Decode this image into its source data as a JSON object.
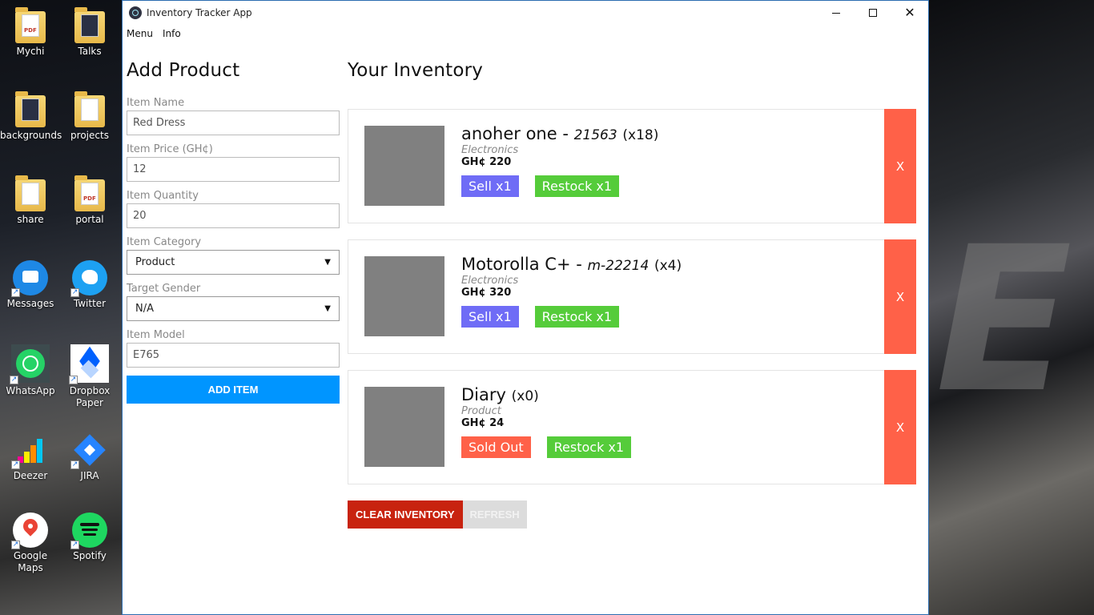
{
  "desktop": {
    "icons": [
      {
        "label": "Mychi"
      },
      {
        "label": "Talks"
      },
      {
        "label": "backgrounds"
      },
      {
        "label": "projects"
      },
      {
        "label": "share"
      },
      {
        "label": "portal"
      },
      {
        "label": "Messages"
      },
      {
        "label": "Twitter"
      },
      {
        "label": "WhatsApp"
      },
      {
        "label": "Dropbox Paper"
      },
      {
        "label": "Deezer"
      },
      {
        "label": "JIRA"
      },
      {
        "label": "Google Maps"
      },
      {
        "label": "Spotify"
      }
    ]
  },
  "window": {
    "title": "Inventory Tracker App",
    "menu": [
      "Menu",
      "Info"
    ]
  },
  "form": {
    "title": "Add Product",
    "item_name_label": "Item Name",
    "item_name_value": "Red Dress",
    "item_price_label": "Item Price (GH¢)",
    "item_price_value": "12",
    "item_quantity_label": "Item Quantity",
    "item_quantity_value": "20",
    "item_category_label": "Item Category",
    "item_category_value": "Product",
    "target_gender_label": "Target Gender",
    "target_gender_value": "N/A",
    "item_model_label": "Item Model",
    "item_model_value": "E765",
    "add_button": "ADD ITEM"
  },
  "inventory": {
    "title": "Your Inventory",
    "items": [
      {
        "name": "anoher one",
        "separator": " - ",
        "model": "21563",
        "qty": "(x18)",
        "category": "Electronics",
        "price": "GH¢ 220",
        "sell_label": "Sell x1",
        "restock_label": "Restock x1",
        "delete_label": "X"
      },
      {
        "name": "Motorolla C+",
        "separator": " - ",
        "model": "m-22214",
        "qty": "(x4)",
        "category": "Electronics",
        "price": "GH¢ 320",
        "sell_label": "Sell x1",
        "restock_label": "Restock x1",
        "delete_label": "X"
      },
      {
        "name": "Diary",
        "separator": "",
        "model": "",
        "qty": "(x0)",
        "category": "Product",
        "price": "GH¢ 24",
        "sell_label": "Sold Out",
        "restock_label": "Restock x1",
        "delete_label": "X"
      }
    ],
    "clear_button": "CLEAR INVENTORY",
    "refresh_button": "REFRESH"
  },
  "colors": {
    "add_button": "#0095ff",
    "sell": "#6f6cf6",
    "sold_out": "#ff6148",
    "restock": "#55cc3a",
    "delete": "#ff6148",
    "clear": "#c8230f",
    "refresh": "#dcdcdc"
  }
}
